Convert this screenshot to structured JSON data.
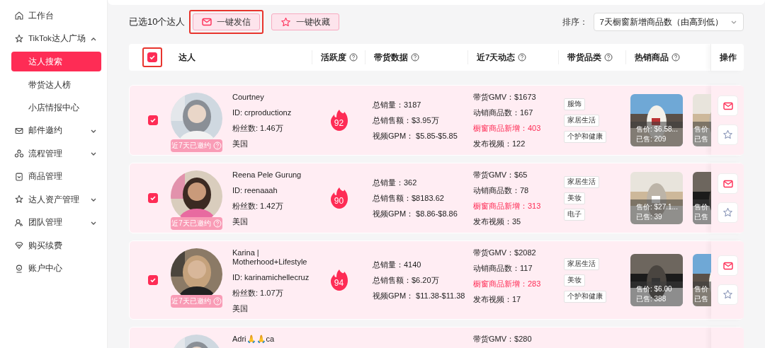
{
  "sidebar": {
    "items": [
      {
        "label": "工作台"
      },
      {
        "label": "TikTok达人广场",
        "expanded": true,
        "children": [
          {
            "label": "达人搜索",
            "selected": true
          },
          {
            "label": "带货达人榜",
            "selected": false
          },
          {
            "label": "小店情报中心",
            "selected": false
          }
        ]
      },
      {
        "label": "邮件邀约",
        "expanded": false
      },
      {
        "label": "流程管理",
        "expanded": false
      },
      {
        "label": "商品管理"
      },
      {
        "label": "达人资产管理",
        "expanded": false
      },
      {
        "label": "团队管理",
        "expanded": false
      },
      {
        "label": "购买续费"
      },
      {
        "label": "账户中心"
      }
    ]
  },
  "toolbar": {
    "selection": "已选10个达人",
    "buttons": [
      {
        "label": "一键发信",
        "highlighted": true
      },
      {
        "label": "一键收藏",
        "highlighted": false
      }
    ],
    "sort_label": "排序：",
    "sort_value": "7天橱窗新增商品数（由高到低）"
  },
  "table": {
    "select_all": {
      "checked": true,
      "highlighted": true
    },
    "columns": [
      {
        "label": "达人",
        "help": false
      },
      {
        "label": "活跃度",
        "help": true
      },
      {
        "label": "带货数据",
        "help": true
      },
      {
        "label": "近7天动态",
        "help": true
      },
      {
        "label": "带货品类",
        "help": true
      },
      {
        "label": "热销商品",
        "help": true
      },
      {
        "label": "操作",
        "help": false
      }
    ],
    "rows": [
      {
        "checked": true,
        "invited": "近7天已邀约",
        "name": "Courtney",
        "id": "ID: crproductionz",
        "fans": "粉丝数: 1.46万",
        "country": "美国",
        "activity": "92",
        "sales": [
          "总销量：3187",
          "总销售额：$3.95万",
          "视频GPM：  $5.85-$5.85"
        ],
        "dynamics": [
          {
            "text": "带货GMV：$1673",
            "highlight": false
          },
          {
            "text": "动销商品数：167",
            "highlight": false
          },
          {
            "text": "橱窗商品新增：403",
            "highlight": true
          },
          {
            "text": "发布视频：122",
            "highlight": false
          }
        ],
        "categories": [
          "服饰",
          "家居生活",
          "个护和健康"
        ],
        "products": [
          {
            "price": "售价: $6.58...",
            "sold": "已售: 209"
          },
          {
            "price": "售价",
            "sold": "已售"
          }
        ]
      },
      {
        "checked": true,
        "invited": "近7天已邀约",
        "name": "Reena Pele Gurung",
        "id": "ID: reenaaah",
        "fans": "粉丝数: 1.42万",
        "country": "美国",
        "activity": "90",
        "sales": [
          "总销量：362",
          "总销售额：$8183.62",
          "视频GPM：  $8.86-$8.86"
        ],
        "dynamics": [
          {
            "text": "带货GMV：$65",
            "highlight": false
          },
          {
            "text": "动销商品数：78",
            "highlight": false
          },
          {
            "text": "橱窗商品新增：313",
            "highlight": true
          },
          {
            "text": "发布视频：35",
            "highlight": false
          }
        ],
        "categories": [
          "家居生活",
          "美妆",
          "电子"
        ],
        "products": [
          {
            "price": "售价: $27.1...",
            "sold": "已售: 39"
          },
          {
            "price": "售价",
            "sold": "已售"
          }
        ]
      },
      {
        "checked": true,
        "invited": "近7天已邀约",
        "name": "Karina | Motherhood+Lifestyle",
        "id": "ID: karinamichellecruz",
        "fans": "粉丝数: 1.07万",
        "country": "美国",
        "activity": "94",
        "sales": [
          "总销量：4140",
          "总销售额：$6.20万",
          "视频GPM：  $11.38-$11.38"
        ],
        "dynamics": [
          {
            "text": "带货GMV：$2082",
            "highlight": false
          },
          {
            "text": "动销商品数：117",
            "highlight": false
          },
          {
            "text": "橱窗商品新增：283",
            "highlight": true
          },
          {
            "text": "发布视频：17",
            "highlight": false
          }
        ],
        "categories": [
          "家居生活",
          "美妆",
          "个护和健康"
        ],
        "products": [
          {
            "price": "售价: $6.00",
            "sold": "已售: 388"
          },
          {
            "price": "售价",
            "sold": "已售"
          }
        ]
      },
      {
        "name": "Adri🙏🙏ca",
        "dynamics": [
          {
            "text": "带货GMV：$280",
            "highlight": false
          }
        ]
      }
    ]
  }
}
